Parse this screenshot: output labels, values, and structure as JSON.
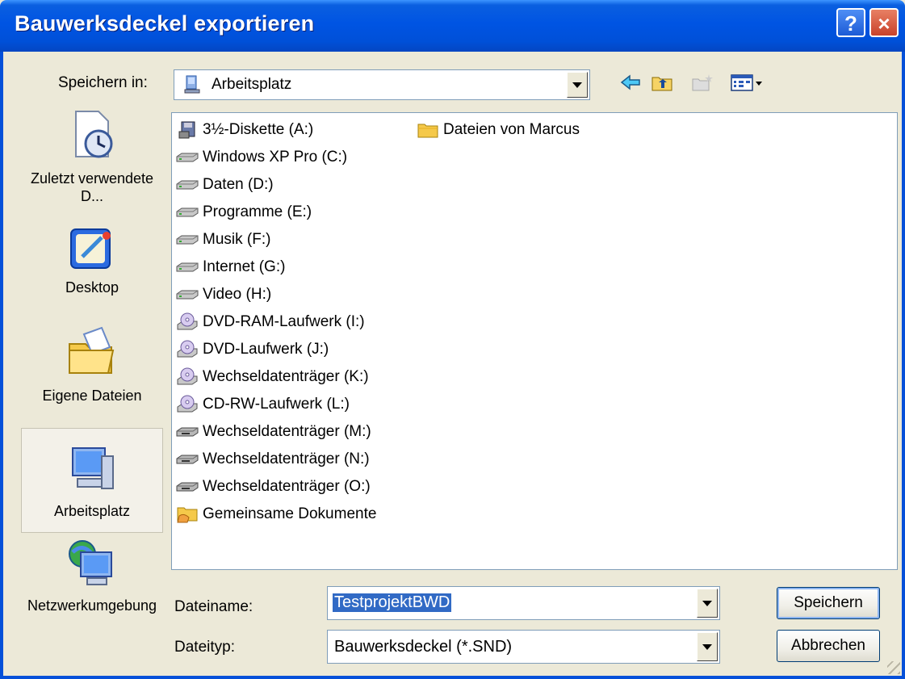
{
  "window": {
    "title": "Bauwerksdeckel exportieren",
    "help_label": "?",
    "close_label": "×"
  },
  "save_in": {
    "label": "Speichern in:",
    "value": "Arbeitsplatz"
  },
  "toolbar": {
    "back_icon": "back-arrow-icon",
    "up_icon": "up-folder-icon",
    "new_folder_icon": "new-folder-icon",
    "views_icon": "view-menu-icon"
  },
  "places": [
    {
      "label": "Zuletzt verwendete D...",
      "icon": "recent-documents-icon"
    },
    {
      "label": "Desktop",
      "icon": "desktop-icon"
    },
    {
      "label": "Eigene Dateien",
      "icon": "my-documents-icon"
    },
    {
      "label": "Arbeitsplatz",
      "icon": "my-computer-icon",
      "selected": true
    },
    {
      "label": "Netzwerkumgebung",
      "icon": "network-icon"
    }
  ],
  "files_col1": [
    {
      "label": "3½-Diskette (A:)",
      "icon": "floppy-icon"
    },
    {
      "label": "Windows XP Pro (C:)",
      "icon": "hard-drive-icon"
    },
    {
      "label": "Daten (D:)",
      "icon": "hard-drive-icon"
    },
    {
      "label": "Programme (E:)",
      "icon": "hard-drive-icon"
    },
    {
      "label": "Musik (F:)",
      "icon": "hard-drive-icon"
    },
    {
      "label": "Internet (G:)",
      "icon": "hard-drive-icon"
    },
    {
      "label": "Video (H:)",
      "icon": "hard-drive-icon"
    },
    {
      "label": "DVD-RAM-Laufwerk (I:)",
      "icon": "cd-drive-icon"
    },
    {
      "label": "DVD-Laufwerk (J:)",
      "icon": "cd-drive-icon"
    },
    {
      "label": "Wechseldatenträger (K:)",
      "icon": "cd-drive-icon"
    },
    {
      "label": "CD-RW-Laufwerk (L:)",
      "icon": "cd-drive-icon"
    },
    {
      "label": "Wechseldatenträger (M:)",
      "icon": "removable-drive-icon"
    },
    {
      "label": "Wechseldatenträger (N:)",
      "icon": "removable-drive-icon"
    },
    {
      "label": "Wechseldatenträger (O:)",
      "icon": "removable-drive-icon"
    },
    {
      "label": "Gemeinsame Dokumente",
      "icon": "shared-folder-icon"
    }
  ],
  "files_col2": [
    {
      "label": "Dateien von Marcus",
      "icon": "folder-icon"
    }
  ],
  "filename": {
    "label": "Dateiname:",
    "value": "TestprojektBWD"
  },
  "filetype": {
    "label": "Dateityp:",
    "value": "Bauwerksdeckel (*.SND)"
  },
  "buttons": {
    "save": "Speichern",
    "cancel": "Abbrechen"
  }
}
